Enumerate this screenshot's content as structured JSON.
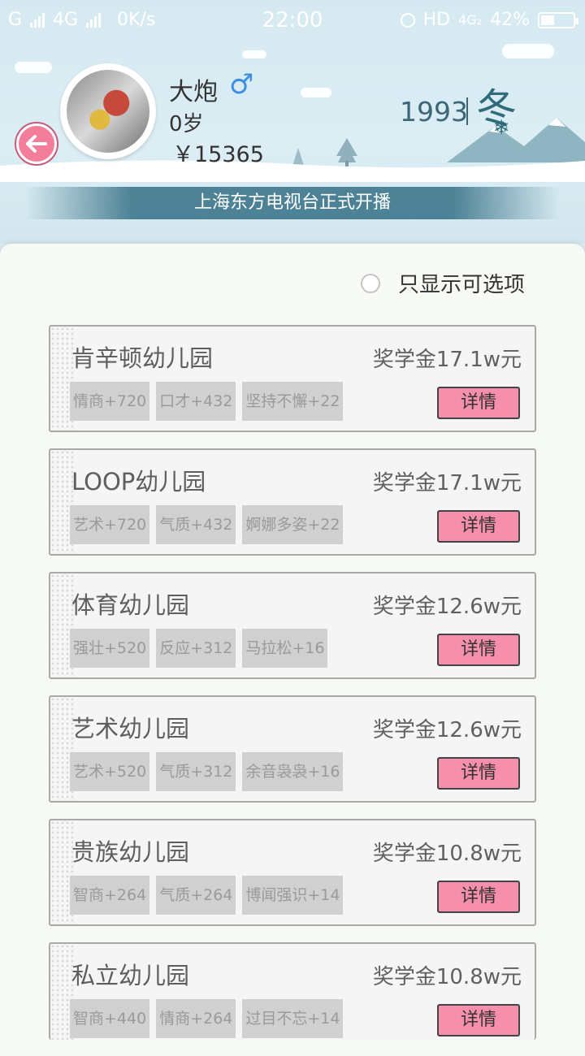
{
  "status_bar": {
    "carrier": "G",
    "network": "4G",
    "speed": "0K/s",
    "time": "22:00",
    "hd_label": "HD",
    "net2": "4G₂",
    "battery": "42%",
    "battery_level": 0.42
  },
  "profile": {
    "name": "大炮",
    "gender_symbol": "♂",
    "age": "0岁",
    "money": "￥15365",
    "year": "1993",
    "season": "冬",
    "season_flake": "❄"
  },
  "banner": "上海东方电视台正式开播",
  "filter": {
    "label": "只显示可选项",
    "checked": false
  },
  "schools": [
    {
      "name": "肯辛顿幼儿园",
      "scholarship": "奖学金17.1w元",
      "tags": [
        "情商+720",
        "口才+432",
        "坚持不懈+22"
      ],
      "detail": "详情"
    },
    {
      "name": "LOOP幼儿园",
      "scholarship": "奖学金17.1w元",
      "tags": [
        "艺术+720",
        "气质+432",
        "婀娜多姿+22"
      ],
      "detail": "详情"
    },
    {
      "name": "体育幼儿园",
      "scholarship": "奖学金12.6w元",
      "tags": [
        "强壮+520",
        "反应+312",
        "马拉松+16"
      ],
      "detail": "详情"
    },
    {
      "name": "艺术幼儿园",
      "scholarship": "奖学金12.6w元",
      "tags": [
        "艺术+520",
        "气质+312",
        "余音袅袅+16"
      ],
      "detail": "详情"
    },
    {
      "name": "贵族幼儿园",
      "scholarship": "奖学金10.8w元",
      "tags": [
        "智商+264",
        "气质+264",
        "博闻强识+14"
      ],
      "detail": "详情"
    },
    {
      "name": "私立幼儿园",
      "scholarship": "奖学金10.8w元",
      "tags": [
        "智商+440",
        "情商+264",
        "过目不忘+14"
      ],
      "detail": "详情"
    }
  ],
  "colors": {
    "detail_button": "#f58fac",
    "back_button": "#f27e9c",
    "gender": "#3f8fe0",
    "banner": "#467d91"
  },
  "icons": {
    "back": "back-arrow-icon",
    "gender": "male-icon",
    "season": "snowflake-icon"
  }
}
